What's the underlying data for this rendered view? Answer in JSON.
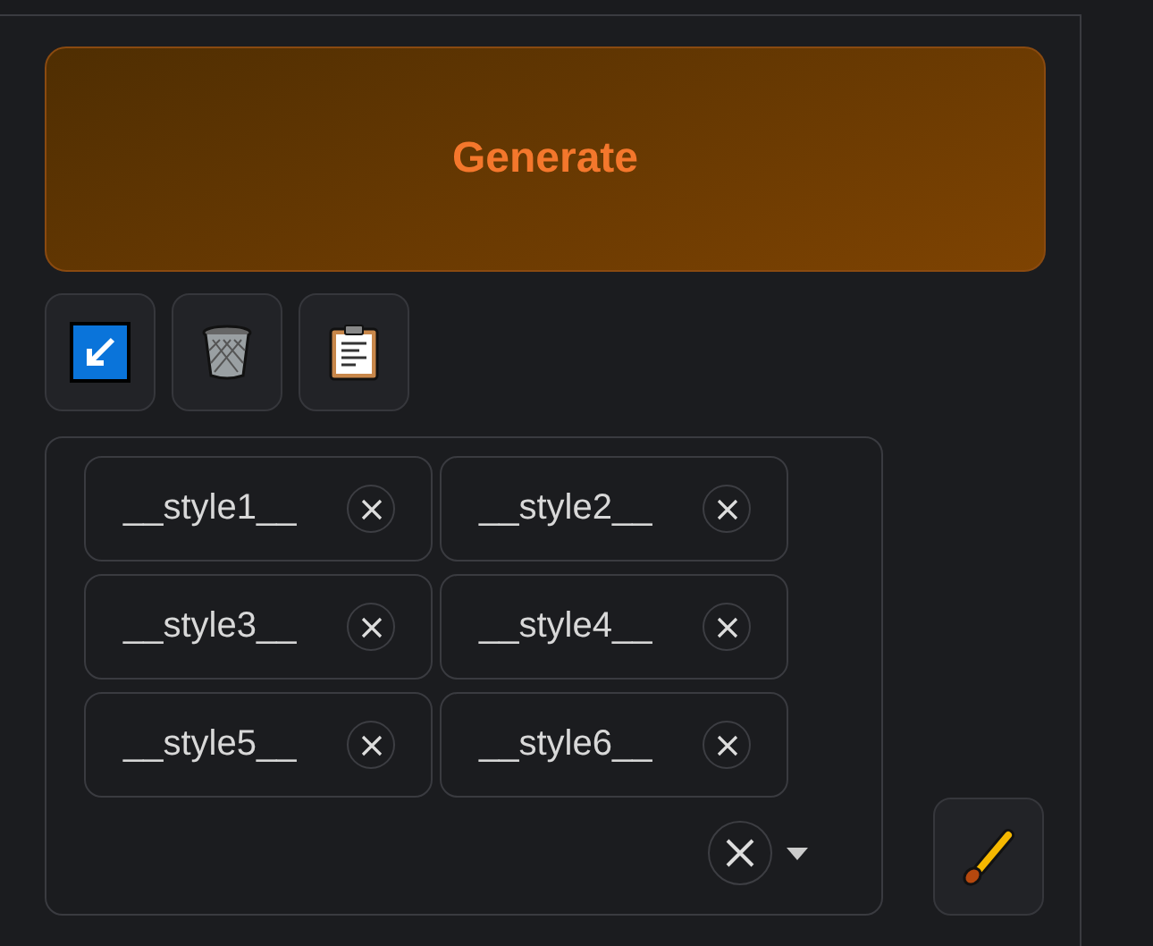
{
  "generate_button": {
    "label": "Generate"
  },
  "style_tags": [
    {
      "label": "__style1__"
    },
    {
      "label": "__style2__"
    },
    {
      "label": "__style3__"
    },
    {
      "label": "__style4__"
    },
    {
      "label": "__style5__"
    },
    {
      "label": "__style6__"
    }
  ]
}
